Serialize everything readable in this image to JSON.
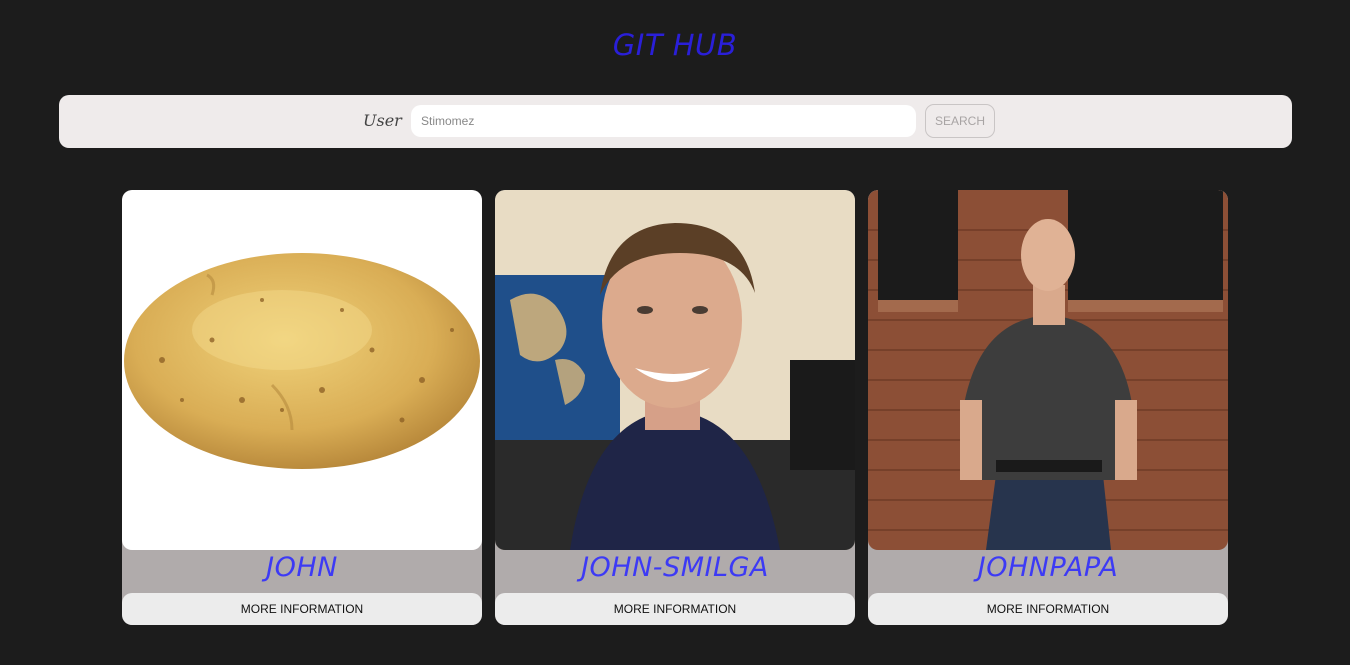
{
  "header": {
    "title": "GIT HUB"
  },
  "search": {
    "label": "User",
    "value": "Stimomez",
    "button_label": "SEARCH"
  },
  "cards": [
    {
      "name": "JOHN",
      "photo": "potato-photo",
      "button_label": "MORE INFORMATION"
    },
    {
      "name": "JOHN-SMILGA",
      "photo": "smiling-man-photo",
      "button_label": "MORE INFORMATION"
    },
    {
      "name": "JOHNPAPA",
      "photo": "standing-man-photo",
      "button_label": "MORE INFORMATION"
    }
  ],
  "colors": {
    "background": "#1c1c1c",
    "title": "#2a1fd9",
    "card_name": "#3d3af5",
    "search_bar": "#efebeb",
    "card_body": "#b0abab"
  }
}
